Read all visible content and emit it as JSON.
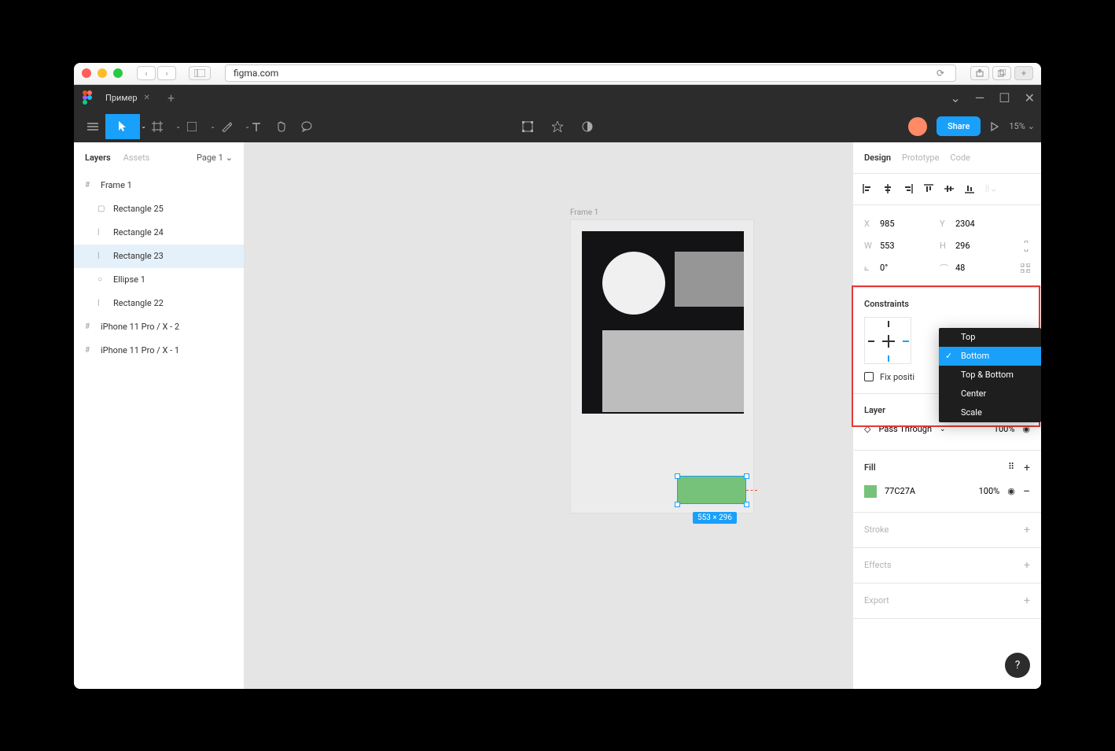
{
  "browser": {
    "url": "figma.com"
  },
  "app": {
    "tab_name": "Пример"
  },
  "toolbar": {
    "share": "Share",
    "zoom": "15%"
  },
  "left_panel": {
    "tabs": {
      "layers": "Layers",
      "assets": "Assets"
    },
    "page": "Page 1",
    "layers": [
      {
        "icon": "#",
        "name": "Frame 1",
        "indent": 0
      },
      {
        "icon": "▢",
        "name": "Rectangle 25",
        "indent": 1
      },
      {
        "icon": "|",
        "name": "Rectangle 24",
        "indent": 1
      },
      {
        "icon": "|",
        "name": "Rectangle 23",
        "indent": 1,
        "selected": true
      },
      {
        "icon": "○",
        "name": "Ellipse 1",
        "indent": 1
      },
      {
        "icon": "|",
        "name": "Rectangle 22",
        "indent": 1
      },
      {
        "icon": "#",
        "name": "iPhone 11 Pro / X - 2",
        "indent": 0
      },
      {
        "icon": "#",
        "name": "iPhone 11 Pro / X - 1",
        "indent": 0
      }
    ]
  },
  "canvas": {
    "frame_label": "Frame 1",
    "size_badge": "553 × 296"
  },
  "right_panel": {
    "tabs": {
      "design": "Design",
      "prototype": "Prototype",
      "code": "Code"
    },
    "props": {
      "x": "985",
      "y": "2304",
      "w": "553",
      "h": "296",
      "rotation": "0°",
      "radius": "48"
    },
    "constraints": {
      "title": "Constraints",
      "fix": "Fix positi"
    },
    "dropdown": {
      "items": [
        "Top",
        "Bottom",
        "Top & Bottom",
        "Center",
        "Scale"
      ],
      "selected": "Bottom"
    },
    "layer": {
      "title": "Layer",
      "blend": "Pass Through",
      "opacity": "100%"
    },
    "fill": {
      "title": "Fill",
      "hex": "77C27A",
      "opacity": "100%"
    },
    "stroke": "Stroke",
    "effects": "Effects",
    "export": "Export"
  }
}
